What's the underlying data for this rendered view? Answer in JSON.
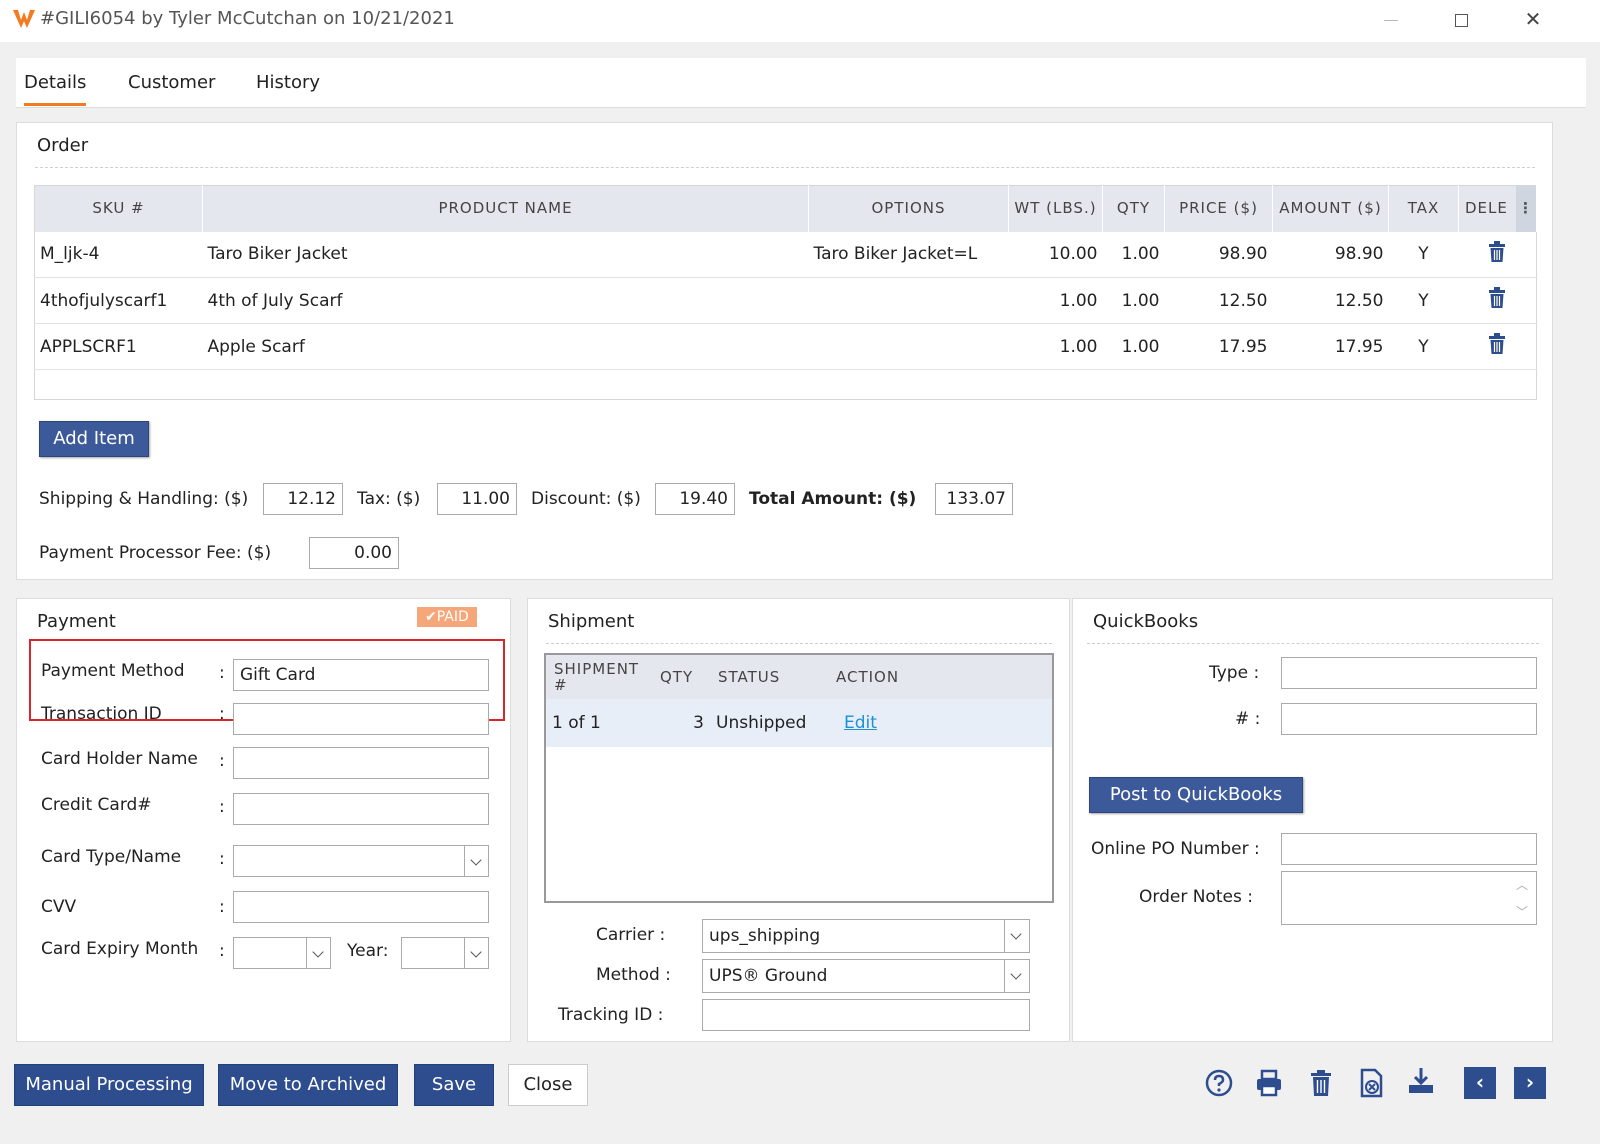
{
  "window": {
    "title": "#GILI6054 by Tyler McCutchan on 10/21/2021"
  },
  "tabs": [
    {
      "label": "Details"
    },
    {
      "label": "Customer"
    },
    {
      "label": "History"
    }
  ],
  "order": {
    "title": "Order",
    "columns": [
      "SKU #",
      "PRODUCT NAME",
      "OPTIONS",
      "WT (LBS.)",
      "QTY",
      "PRICE ($)",
      "AMOUNT ($)",
      "TAX",
      "DELE"
    ],
    "rows": [
      {
        "sku": "M_ljk-4",
        "name": "Taro Biker Jacket",
        "options": "Taro Biker Jacket=L",
        "wt": "10.00",
        "qty": "1.00",
        "price": "98.90",
        "amount": "98.90",
        "tax": "Y"
      },
      {
        "sku": "4thofjulyscarf1",
        "name": "4th of July Scarf",
        "options": "",
        "wt": "1.00",
        "qty": "1.00",
        "price": "12.50",
        "amount": "12.50",
        "tax": "Y"
      },
      {
        "sku": "APPLSCRF1",
        "name": "Apple Scarf",
        "options": "",
        "wt": "1.00",
        "qty": "1.00",
        "price": "17.95",
        "amount": "17.95",
        "tax": "Y"
      }
    ],
    "add_item": "Add Item",
    "shipping_label": "Shipping & Handling: ($)",
    "shipping": "12.12",
    "tax_label": "Tax: ($)",
    "tax": "11.00",
    "discount_label": "Discount: ($)",
    "discount": "19.40",
    "total_label": "Total Amount: ($)",
    "total": "133.07",
    "fee_label": "Payment Processor Fee: ($)",
    "fee": "0.00"
  },
  "payment": {
    "title": "Payment",
    "paid_badge": "PAID",
    "method_label": "Payment Method",
    "method": "Gift Card",
    "txn_label": "Transaction ID",
    "holder_label": "Card Holder Name",
    "cc_label": "Credit Card#",
    "type_label": "Card Type/Name",
    "cvv_label": "CVV",
    "expiry_label": "Card Expiry Month",
    "year_label": "Year:",
    "colon": ":"
  },
  "shipment": {
    "title": "Shipment",
    "columns": [
      "SHIPMENT #",
      "QTY",
      "STATUS",
      "ACTION"
    ],
    "rows": [
      {
        "shipment": "1 of 1",
        "qty": "3",
        "status": "Unshipped",
        "action": "Edit"
      }
    ],
    "carrier_label": "Carrier :",
    "carrier": "ups_shipping",
    "method_label": "Method :",
    "method": "UPS® Ground",
    "tracking_label": "Tracking ID :"
  },
  "quickbooks": {
    "title": "QuickBooks",
    "type_label": "Type :",
    "num_label": "# :",
    "post_button": "Post to QuickBooks",
    "po_label": "Online PO Number :",
    "notes_label": "Order Notes :"
  },
  "footer": {
    "manual": "Manual Processing",
    "archive": "Move to Archived",
    "save": "Save",
    "close": "Close"
  },
  "colors": {
    "accent": "#f27a21",
    "primary": "#2e4d8f",
    "highlight": "#d9262c"
  }
}
